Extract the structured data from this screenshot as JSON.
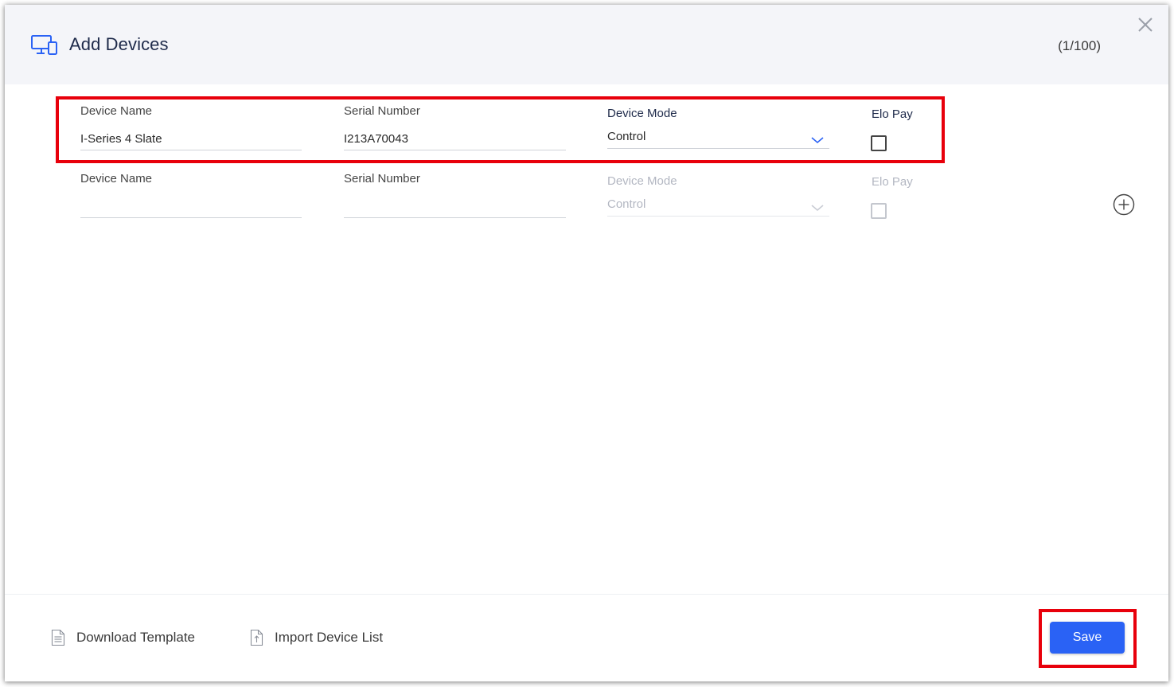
{
  "dialog": {
    "title": "Add Devices",
    "count": "(1/100)",
    "icon": "devices-icon",
    "close_icon": "close-icon"
  },
  "rows": [
    {
      "device_name_label": "Device Name",
      "device_name_value": "I-Series 4 Slate",
      "serial_label": "Serial Number",
      "serial_value": "I213A70043",
      "mode_label": "Device Mode",
      "mode_value": "Control",
      "elo_pay_label": "Elo Pay",
      "elo_pay_checked": false,
      "enabled": true
    },
    {
      "device_name_label": "Device Name",
      "device_name_value": "",
      "serial_label": "Serial Number",
      "serial_value": "",
      "mode_label": "Device Mode",
      "mode_value": "Control",
      "elo_pay_label": "Elo Pay",
      "elo_pay_checked": false,
      "enabled": false
    }
  ],
  "add_row_icon": "plus-circle-icon",
  "footer": {
    "download_label": "Download Template",
    "import_label": "Import Device List",
    "download_icon": "document-icon",
    "import_icon": "upload-file-icon",
    "save_label": "Save"
  },
  "colors": {
    "accent": "#2a62f5",
    "highlight": "#e8000b",
    "title": "#1e2a4a",
    "header_bg": "#f4f5f9"
  }
}
